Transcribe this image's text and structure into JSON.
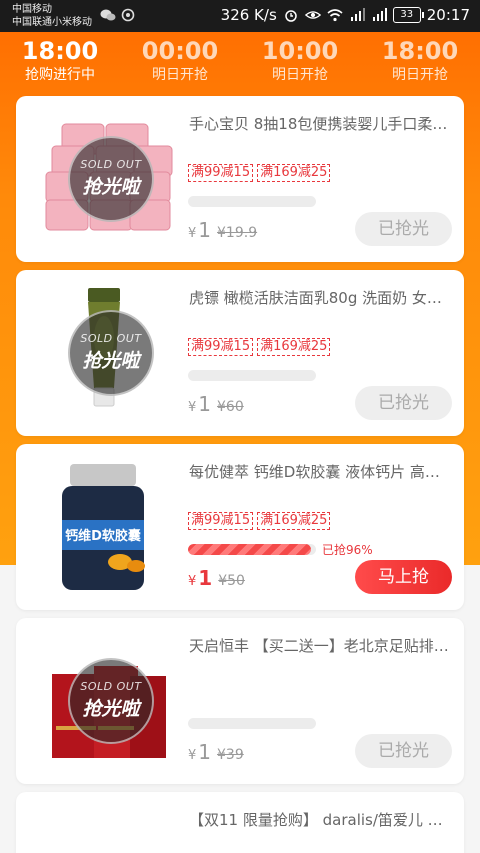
{
  "status_bar": {
    "carrier1": "中国移动",
    "carrier2": "中国联通小米移动",
    "speed": "326 K/s",
    "battery": "33",
    "time": "20:17"
  },
  "tabs": [
    {
      "time": "18:00",
      "status": "抢购进行中",
      "active": true
    },
    {
      "time": "00:00",
      "status": "明日开抢",
      "active": false
    },
    {
      "time": "10:00",
      "status": "明日开抢",
      "active": false
    },
    {
      "time": "18:00",
      "status": "明日开抢",
      "active": false
    }
  ],
  "sold_out_badge": {
    "en": "SOLD OUT",
    "cn": "抢光啦"
  },
  "products": [
    {
      "name": "手心宝贝 8抽18包便携装婴儿手口柔…",
      "coupons": [
        "满99减15",
        "满169减25"
      ],
      "progress": 0,
      "sold_label": "",
      "currency": "¥",
      "price": "1",
      "original_price": "¥19.9",
      "button": "已抢光",
      "sold_out": true
    },
    {
      "name": "虎镖 橄榄活肤洁面乳80g 洗面奶 女…",
      "coupons": [
        "满99减15",
        "满169减25"
      ],
      "progress": 0,
      "sold_label": "",
      "currency": "¥",
      "price": "1",
      "original_price": "¥60",
      "button": "已抢光",
      "sold_out": true
    },
    {
      "name": "每优健萃 钙维D软胶囊 液体钙片 高含…",
      "coupons": [
        "满99减15",
        "满169减25"
      ],
      "progress": 0.96,
      "sold_label": "已抢96%",
      "currency": "¥",
      "price": "1",
      "original_price": "¥50",
      "button": "马上抢",
      "sold_out": false
    },
    {
      "name": "天启恒丰 【买二送一】老北京足贴排…",
      "coupons": [],
      "progress": 0,
      "sold_label": "",
      "currency": "¥",
      "price": "1",
      "original_price": "¥39",
      "button": "已抢光",
      "sold_out": true
    },
    {
      "name": "【双11 限量抢购】 daralis/笛爱儿 口…",
      "coupons": [],
      "progress": 0,
      "sold_label": "",
      "currency": "",
      "price": "",
      "original_price": "",
      "button": "",
      "sold_out": false
    }
  ],
  "colors": {
    "accent": "#ff6a00",
    "price_red": "#e8383d",
    "button_red": "#ef3333"
  }
}
